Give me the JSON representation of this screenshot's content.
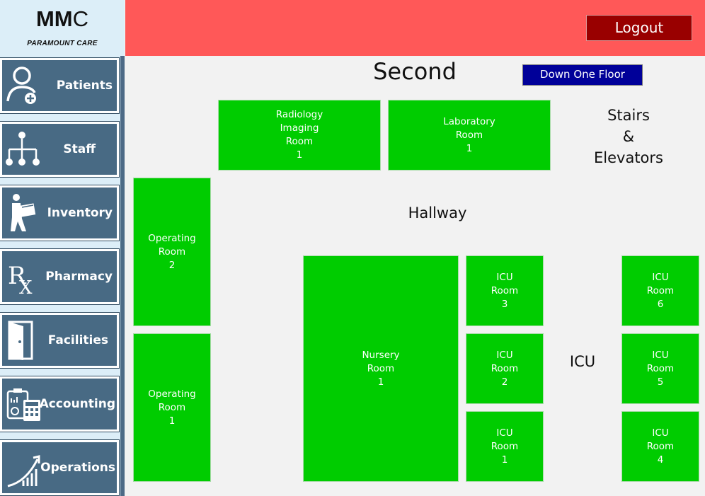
{
  "app": {
    "brand": "MMC",
    "brand_main": "MM",
    "brand_c": "C",
    "tagline": "PARAMOUNT CARE"
  },
  "header": {
    "logout_label": "Logout",
    "accent_color": "#ff5858",
    "logout_color": "#990000"
  },
  "sidebar": {
    "items": [
      {
        "label": "Patients",
        "icon": "patient-icon"
      },
      {
        "label": "Staff",
        "icon": "org-chart-icon"
      },
      {
        "label": "Inventory",
        "icon": "person-carrying-box-icon"
      },
      {
        "label": "Pharmacy",
        "icon": "rx-icon"
      },
      {
        "label": "Facilities",
        "icon": "door-icon"
      },
      {
        "label": "Accounting",
        "icon": "calculator-clipboard-icon"
      },
      {
        "label": "Operations",
        "icon": "growth-chart-icon"
      }
    ]
  },
  "floor": {
    "title": "Second",
    "down_button": "Down One Floor"
  },
  "rooms": {
    "radiology": "Radiology\nImaging\nRoom\n1",
    "laboratory": "Laboratory\nRoom\n1",
    "operating_2": "Operating\nRoom\n2",
    "operating_1": "Operating\nRoom\n1",
    "nursery": "Nursery\nRoom\n1",
    "icu_3": "ICU\nRoom\n3",
    "icu_2": "ICU\nRoom\n2",
    "icu_1": "ICU\nRoom\n1",
    "icu_6": "ICU\nRoom\n6",
    "icu_5": "ICU\nRoom\n5",
    "icu_4": "ICU\nRoom\n4",
    "room_color": "#00cc00"
  },
  "areas": {
    "stairs": "Stairs\n&\nElevators",
    "hallway": "Hallway",
    "icu": "ICU"
  }
}
